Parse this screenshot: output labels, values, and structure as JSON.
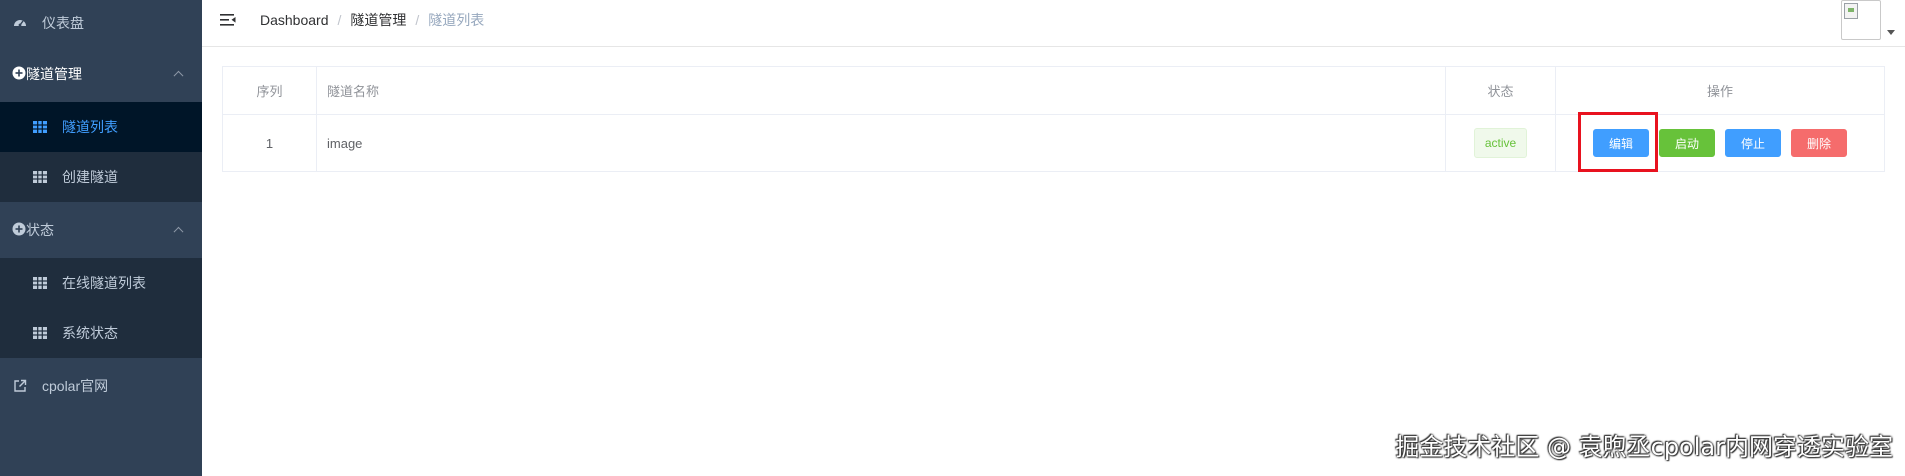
{
  "sidebar": {
    "dashboard": "仪表盘",
    "tunnel_mgmt": "隧道管理",
    "tunnel_list": "隧道列表",
    "create_tunnel": "创建隧道",
    "status": "状态",
    "online_list": "在线隧道列表",
    "system_status": "系统状态",
    "official_site": "cpolar官网"
  },
  "breadcrumb": {
    "items": [
      "Dashboard",
      "隧道管理",
      "隧道列表"
    ],
    "separator": "/"
  },
  "table": {
    "headers": [
      "序列",
      "隧道名称",
      "状态",
      "操作"
    ],
    "rows": [
      {
        "index": "1",
        "name": "image",
        "status": "active"
      }
    ],
    "actions": {
      "edit": "编辑",
      "start": "启动",
      "stop": "停止",
      "delete": "删除"
    }
  },
  "watermark": "掘金技术社区 @ 袁煦丞cpolar内网穿透实验室",
  "colors": {
    "sidebar_bg": "#304156",
    "submenu_bg": "#1f2d3d",
    "active_bg": "#001528",
    "accent": "#409eff",
    "success": "#67c23a",
    "danger": "#f56c6c",
    "highlight_box": "#e8121f"
  }
}
